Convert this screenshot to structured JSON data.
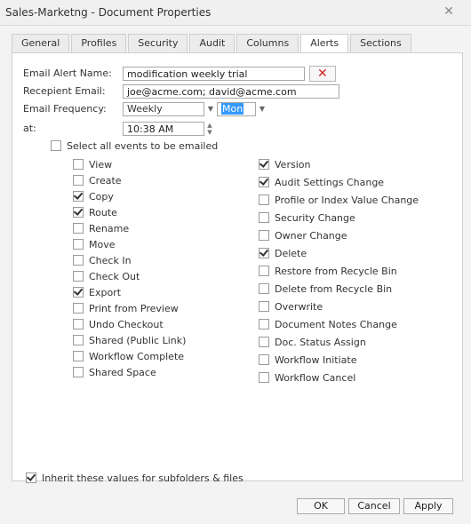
{
  "window": {
    "title": "Sales-Marketng - Document Properties"
  },
  "tabs": [
    "General",
    "Profiles",
    "Security",
    "Audit",
    "Columns",
    "Alerts",
    "Sections"
  ],
  "form": {
    "alert_name_label": "Email Alert Name:",
    "alert_name_value": "modification weekly trial",
    "recipient_label": "Recepient Email:",
    "recipient_value": "joe@acme.com; david@acme.com",
    "frequency_label": "Email Frequency:",
    "frequency_value": "Weekly",
    "day_value": "Mon",
    "at_label": "at:",
    "time_value": "10:38 AM"
  },
  "select_all": {
    "label": "Select all events to be emailed",
    "checked": false
  },
  "events_left": [
    {
      "label": "View",
      "checked": false
    },
    {
      "label": "Create",
      "checked": false
    },
    {
      "label": "Copy",
      "checked": true
    },
    {
      "label": "Route",
      "checked": true
    },
    {
      "label": "Rename",
      "checked": false
    },
    {
      "label": "Move",
      "checked": false
    },
    {
      "label": "Check In",
      "checked": false
    },
    {
      "label": "Check Out",
      "checked": false
    },
    {
      "label": "Export",
      "checked": true
    },
    {
      "label": "Print from Preview",
      "checked": false
    },
    {
      "label": "Undo Checkout",
      "checked": false
    },
    {
      "label": "Shared (Public Link)",
      "checked": false
    },
    {
      "label": "Workflow Complete",
      "checked": false
    },
    {
      "label": "Shared Space",
      "checked": false
    }
  ],
  "events_right": [
    {
      "label": "Version",
      "checked": true
    },
    {
      "label": "Audit Settings Change",
      "checked": true
    },
    {
      "label": "Profile or Index Value Change",
      "checked": false
    },
    {
      "label": "Security Change",
      "checked": false
    },
    {
      "label": "Owner Change",
      "checked": false
    },
    {
      "label": "Delete",
      "checked": true
    },
    {
      "label": "Restore from Recycle Bin",
      "checked": false
    },
    {
      "label": "Delete from Recycle Bin",
      "checked": false
    },
    {
      "label": "Overwrite",
      "checked": false
    },
    {
      "label": "Document Notes Change",
      "checked": false
    },
    {
      "label": "Doc. Status Assign",
      "checked": false
    },
    {
      "label": "Workflow Initiate",
      "checked": false
    },
    {
      "label": "Workflow Cancel",
      "checked": false
    }
  ],
  "inherit": {
    "label": "Inherit these values for subfolders & files",
    "checked": true
  },
  "buttons": {
    "ok": "OK",
    "cancel": "Cancel",
    "apply": "Apply"
  }
}
